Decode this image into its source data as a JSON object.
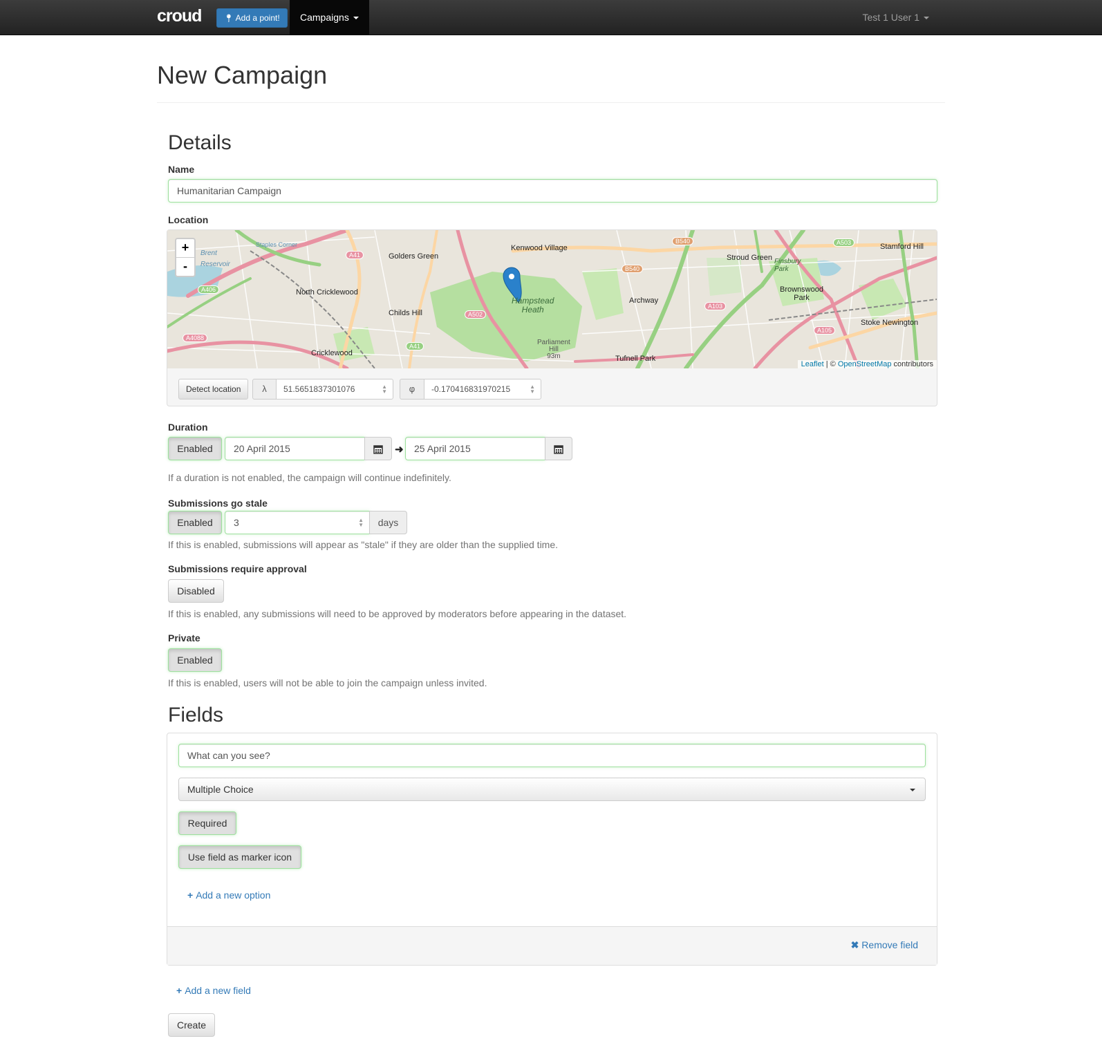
{
  "navbar": {
    "brand": "croud",
    "add_point_label": "Add a point!",
    "campaigns_label": "Campaigns",
    "user_label": "Test 1 User 1"
  },
  "page": {
    "title": "New Campaign"
  },
  "details": {
    "heading": "Details",
    "name_label": "Name",
    "name_value": "Humanitarian Campaign",
    "location_label": "Location",
    "map": {
      "zoom_in": "+",
      "zoom_out": "-",
      "place_labels": [
        "Kenwood Village",
        "Golders Green",
        "North Cricklewood",
        "Childs Hill",
        "Cricklewood",
        "Hampstead Heath",
        "Archway",
        "Stroud Green",
        "Brownswood Park",
        "Stoke Newington",
        "Stamford Hill",
        "Tufnell Park",
        "Parliament Hill 93m",
        "Finsbury Park",
        "Brent Reservoir",
        "Staples Corner"
      ],
      "road_labels": [
        "A41",
        "A406",
        "A4088",
        "A502",
        "A41",
        "B540",
        "B540",
        "A503",
        "A103",
        "A105"
      ],
      "attribution_leaflet": "Leaflet",
      "attribution_sep": " | © ",
      "attribution_osm": "OpenStreetMap",
      "attribution_tail": " contributors"
    },
    "detect_location_label": "Detect location",
    "lat_symbol": "λ",
    "lat_value": "51.5651837301076",
    "lng_symbol": "φ",
    "lng_value": "-0.170416831970215"
  },
  "duration": {
    "label": "Duration",
    "toggle": "Enabled",
    "start": "20 April 2015",
    "end": "25 April 2015",
    "help": "If a duration is not enabled, the campaign will continue indefinitely."
  },
  "stale": {
    "label": "Submissions go stale",
    "toggle": "Enabled",
    "value": "3",
    "unit": "days",
    "help": "If this is enabled, submissions will appear as \"stale\" if they are older than the supplied time."
  },
  "approval": {
    "label": "Submissions require approval",
    "toggle": "Disabled",
    "help": "If this is enabled, any submissions will need to be approved by moderators before appearing in the dataset."
  },
  "private": {
    "label": "Private",
    "toggle": "Enabled",
    "help": "If this is enabled, users will not be able to join the campaign unless invited."
  },
  "fields": {
    "heading": "Fields",
    "items": [
      {
        "question": "What can you see?",
        "type": "Multiple Choice",
        "required_label": "Required",
        "marker_label": "Use field as marker icon",
        "add_option": "Add a new option",
        "remove_field": "Remove field"
      }
    ],
    "add_field": "Add a new field",
    "create_label": "Create"
  },
  "colors": {
    "accent": "#337ab7",
    "navbar": "#222222",
    "valid_border": "#9ee09e",
    "map_marker": "#2a81cb"
  }
}
